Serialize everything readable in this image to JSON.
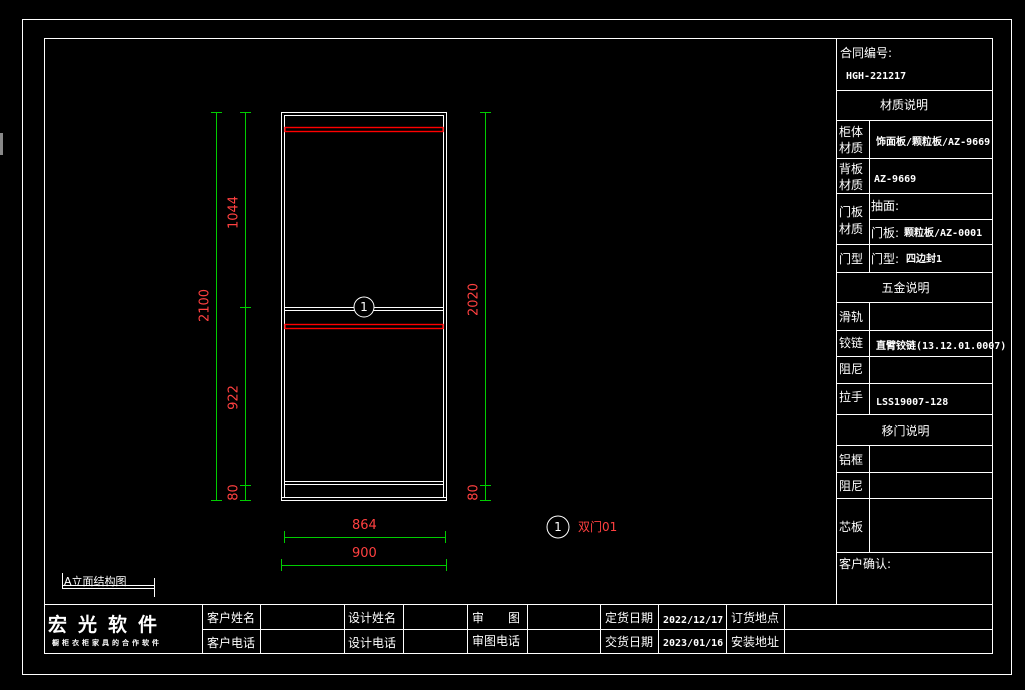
{
  "panel": {
    "contract_label": "合同编号:",
    "contract_no": "HGH-221217",
    "material_header": "材质说明",
    "cabinet_label_1": "柜体",
    "cabinet_label_2": "材质",
    "cabinet_value": "饰面板/颗粒板/AZ-9669",
    "back_label_1": "背板",
    "back_label_2": "材质",
    "back_value": "AZ-9669",
    "door_label_1": "门板",
    "door_label_2": "材质",
    "door_drawer": "抽面:",
    "door_panel_prefix": "门板:",
    "door_panel_value": "颗粒板/AZ-0001",
    "door_type_label": "门型",
    "door_type_prefix": "门型:",
    "door_type_value": "四边封1",
    "hardware_header": "五金说明",
    "rail_label": "滑轨",
    "hinge_label": "铰链",
    "hinge_value": "直臂铰链(13.12.01.0007)",
    "damper_label": "阻尼",
    "handle_label": "拉手",
    "handle_value": "LSS19007-128",
    "slide_header": "移门说明",
    "frame_label": "铝框",
    "slide_damper_label": "阻尼",
    "core_label": "芯板",
    "confirm_label": "客户确认:"
  },
  "footer": {
    "brand": "宏光软件",
    "brand_sub": "橱柜衣柜家具的合作软件",
    "customer_name": "客户姓名",
    "customer_phone": "客户电话",
    "designer_name": "设计姓名",
    "designer_phone": "设计电话",
    "review": "审　　图",
    "review_phone": "审图电话",
    "order_date_label": "定货日期",
    "order_date": "2022/12/17",
    "delivery_date_label": "交货日期",
    "delivery_date": "2023/01/16",
    "order_place": "订货地点",
    "install_place": "安装地址"
  },
  "drawing": {
    "view_title": "A立面结构图",
    "marker": "1",
    "legend_marker": "1",
    "legend_text": "双门01",
    "dims": {
      "total_height": "2100",
      "upper": "1044",
      "lower": "922",
      "base_left": "80",
      "inner_height": "2020",
      "base_right": "80",
      "inner_width": "864",
      "outer_width": "900"
    }
  },
  "colors": {
    "background": "#000000",
    "lines": "#ffffff",
    "dimension_lines": "#00cc00",
    "dimension_text": "#ff4040",
    "highlight": "#ff0000"
  }
}
